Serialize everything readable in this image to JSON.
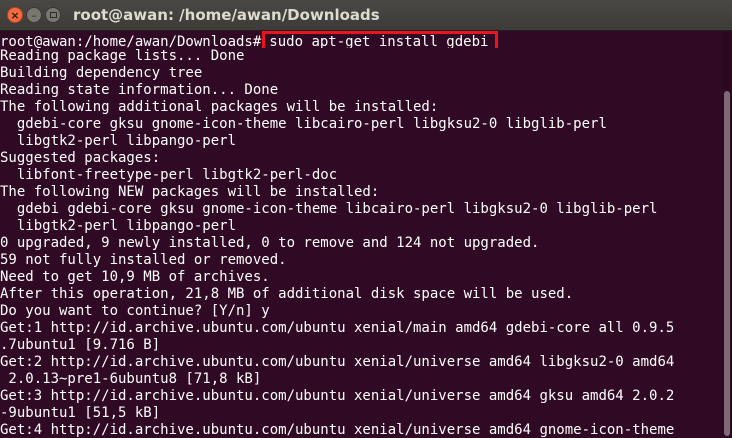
{
  "window": {
    "title": "root@awan: /home/awan/Downloads",
    "buttons": {
      "close": "×",
      "minimize": "–"
    }
  },
  "terminal": {
    "prompt": "root@awan:/home/awan/Downloads#",
    "command": "sudo apt-get install gdebi",
    "output": [
      "Reading package lists... Done",
      "Building dependency tree",
      "Reading state information... Done",
      "The following additional packages will be installed:",
      "  gdebi-core gksu gnome-icon-theme libcairo-perl libgksu2-0 libglib-perl",
      "  libgtk2-perl libpango-perl",
      "Suggested packages:",
      "  libfont-freetype-perl libgtk2-perl-doc",
      "The following NEW packages will be installed:",
      "  gdebi gdebi-core gksu gnome-icon-theme libcairo-perl libgksu2-0 libglib-perl",
      "  libgtk2-perl libpango-perl",
      "0 upgraded, 9 newly installed, 0 to remove and 124 not upgraded.",
      "59 not fully installed or removed.",
      "Need to get 10,9 MB of archives.",
      "After this operation, 21,8 MB of additional disk space will be used.",
      "Do you want to continue? [Y/n] y",
      "Get:1 http://id.archive.ubuntu.com/ubuntu xenial/main amd64 gdebi-core all 0.9.5",
      ".7ubuntu1 [9.716 B]",
      "Get:2 http://id.archive.ubuntu.com/ubuntu xenial/universe amd64 libgksu2-0 amd64",
      " 2.0.13~pre1-6ubuntu8 [71,8 kB]",
      "Get:3 http://id.archive.ubuntu.com/ubuntu xenial/universe amd64 gksu amd64 2.0.2",
      "-9ubuntu1 [51,5 kB]",
      "Get:4 http://id.archive.ubuntu.com/ubuntu xenial/universe amd64 gnome-icon-theme"
    ]
  },
  "colors": {
    "terminal_bg": "#300a24",
    "terminal_fg": "#ffffff",
    "highlight_border": "#e8141e",
    "titlebar_bg": "#3c3b37",
    "close_button": "#f06a42"
  }
}
